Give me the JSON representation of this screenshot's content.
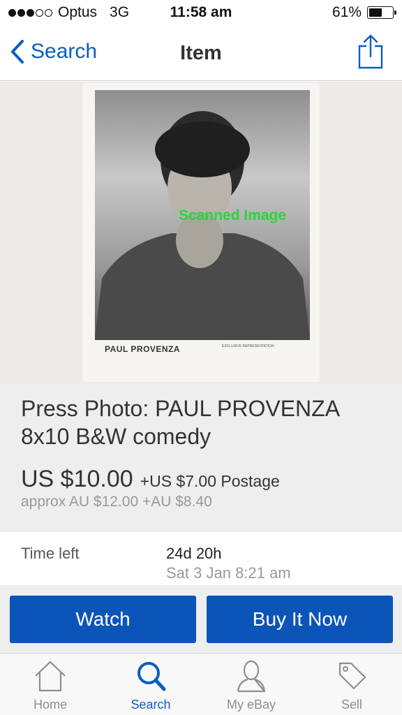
{
  "status_bar": {
    "carrier": "Optus",
    "network": "3G",
    "time": "11:58 am",
    "battery": "61%",
    "battery_level": 0.61,
    "signal_bars": 3,
    "signal_total": 5
  },
  "nav": {
    "back_label": "Search",
    "title": "Item",
    "share_icon": "share-icon"
  },
  "image": {
    "caption": "PAUL PROVENZA",
    "watermark": "Scanned Image",
    "rep_text": "EXCLUSIVE REPRESENTATION"
  },
  "item": {
    "title": "Press Photo: PAUL PROVENZA 8x10 B&W comedy",
    "price": "US $10.00",
    "postage": "+US $7.00 Postage",
    "approx": "approx AU $12.00 +AU $8.40"
  },
  "time": {
    "label": "Time left",
    "value": "24d 20h",
    "end": "Sat 3 Jan 8:21 am"
  },
  "actions": {
    "watch": "Watch",
    "buy_now": "Buy It Now"
  },
  "tabs": [
    {
      "label": "Home",
      "icon": "home-icon"
    },
    {
      "label": "Search",
      "icon": "search-icon",
      "active": true
    },
    {
      "label": "My eBay",
      "icon": "user-icon"
    },
    {
      "label": "Sell",
      "icon": "tag-icon"
    }
  ],
  "colors": {
    "accent": "#0a5dc2",
    "button": "#0c55b8",
    "watermark": "#28d63a"
  }
}
